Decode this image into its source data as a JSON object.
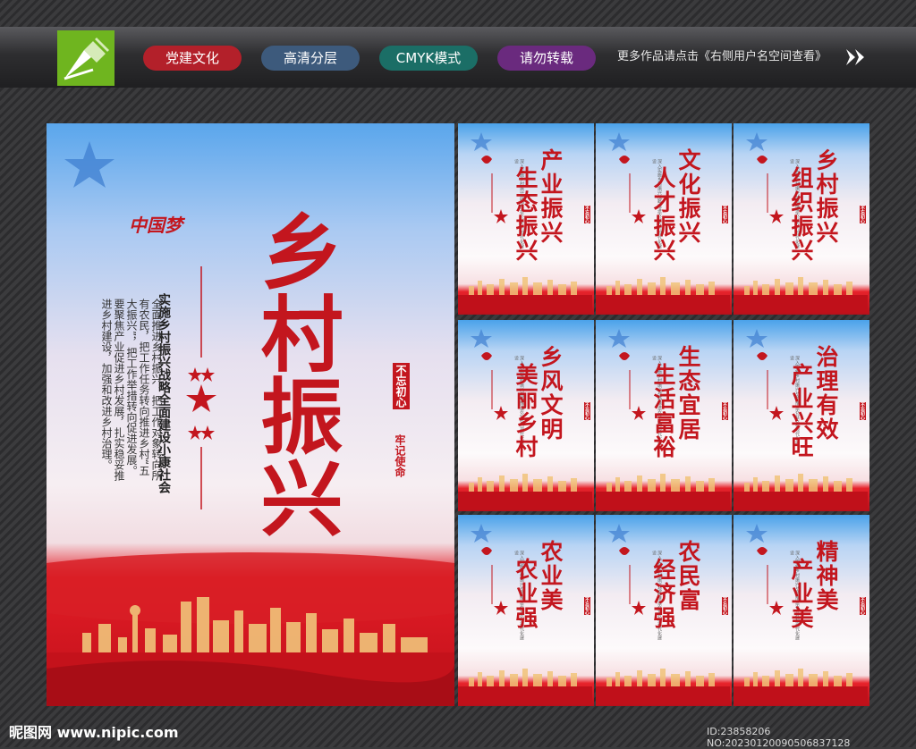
{
  "header": {
    "pills": [
      {
        "label": "党建文化",
        "color": "#b3202a"
      },
      {
        "label": "高清分层",
        "color": "#3d5a7c"
      },
      {
        "label": "CMYK模式",
        "color": "#1b6e66"
      },
      {
        "label": "请勿转载",
        "color": "#6a2a7e"
      }
    ],
    "note": "更多作品请点击《右侧用户名空间查看》"
  },
  "main_poster": {
    "title": "乡村振兴",
    "logo_text": "中国梦",
    "subtitle": "实施乡村振兴战略全面建设小康社会",
    "body": "全面推进乡村振兴，把工作对象转向所有农民，把工作任务转向推进乡村“五大振兴”，把工作举措转向促进发展。要聚焦产业促进乡村发展，扎实稳妥推进乡村建设，加强和改进乡村治理。",
    "badge_1": "不忘初心",
    "badge_2": "牢记使命"
  },
  "small_posters": [
    {
      "col1": "产业振兴",
      "col2": "生态振兴"
    },
    {
      "col1": "文化振兴",
      "col2": "人才振兴"
    },
    {
      "col1": "乡村振兴",
      "col2": "组织振兴"
    },
    {
      "col1": "乡风文明",
      "col2": "美丽乡村"
    },
    {
      "col1": "生态宜居",
      "col2": "生活富裕"
    },
    {
      "col1": "治理有效",
      "col2": "产业兴旺"
    },
    {
      "col1": "农业美",
      "col2": "农业强"
    },
    {
      "col1": "农民富",
      "col2": "经济强"
    },
    {
      "col1": "精神美",
      "col2": "产业美"
    }
  ],
  "footer": {
    "site": "昵图网 www.nipic.com",
    "id": "ID:23858206 NO:20230120090506837128"
  },
  "colors": {
    "brand_red": "#c3161e",
    "logo_green": "#6fb51f"
  }
}
